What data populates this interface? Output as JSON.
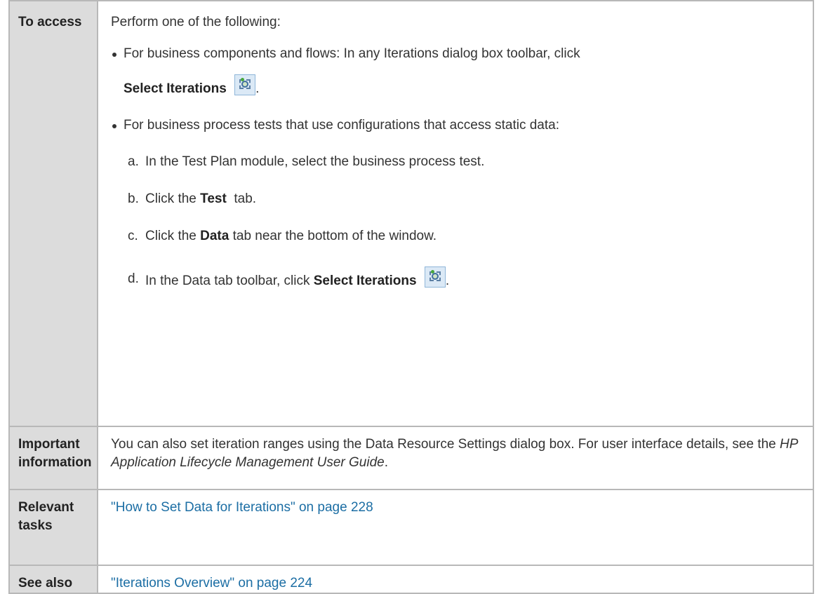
{
  "rows": {
    "access": {
      "label": "To access",
      "intro": "Perform one of the following:",
      "bullet1": {
        "text": "For business components and flows: In any Iterations dialog box toolbar, click",
        "bold": "Select Iterations",
        "end": ".",
        "icon": "select-iterations-icon"
      },
      "bullet2": {
        "text": "For business process tests that use configurations that access static data:",
        "steps": {
          "a": {
            "letter": "a.",
            "text": "In the Test Plan module, select the business process test."
          },
          "b": {
            "letter": "b.",
            "pre": "Click the ",
            "bold": "Test",
            "post": "  tab."
          },
          "c": {
            "letter": "c.",
            "pre": "Click the ",
            "bold": "Data",
            "post": " tab near the bottom of the window."
          },
          "d": {
            "letter": "d.",
            "pre": "In the Data tab toolbar, click ",
            "bold": "Select Iterations",
            "end": "."
          }
        }
      }
    },
    "important": {
      "label": "Important information",
      "text1": "You can also set iteration ranges using the Data Resource Settings dialog box. For user interface details, see the ",
      "italic": "HP Application Lifecycle Management User Guide",
      "end": "."
    },
    "tasks": {
      "label": "Relevant tasks",
      "link": "\"How to Set Data for Iterations\" on page 228"
    },
    "see_also": {
      "label": "See also",
      "link": "\"Iterations Overview\" on page 224"
    }
  },
  "colors": {
    "link": "#1c6ea4",
    "label_bg": "#dcdcdc",
    "border": "#b8b8b8"
  }
}
